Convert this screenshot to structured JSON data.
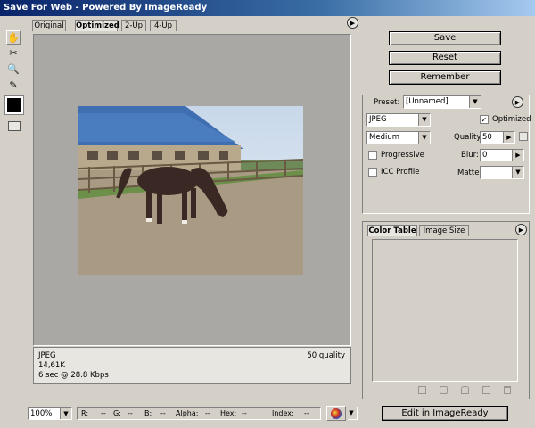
{
  "window": {
    "title": "Save For Web - Powered By ImageReady"
  },
  "tabs": [
    {
      "label": "Original"
    },
    {
      "label": "Optimized",
      "active": true
    },
    {
      "label": "2-Up"
    },
    {
      "label": "4-Up"
    }
  ],
  "image_info": {
    "format": "JPEG",
    "size": "14,61K",
    "time": "6 sec @ 28.8 Kbps",
    "quality": "50 quality"
  },
  "buttons": {
    "save": "Save",
    "reset": "Reset",
    "remember": "Remember",
    "edit_imageready": "Edit in ImageReady"
  },
  "settings": {
    "preset_label": "Preset:",
    "preset_value": "[Unnamed]",
    "format": "JPEG",
    "optimized_label": "Optimized",
    "optimized_checked": true,
    "quality_level": "Medium",
    "quality_label": "Quality:",
    "quality_value": "50",
    "progressive_label": "Progressive",
    "progressive_checked": false,
    "blur_label": "Blur:",
    "blur_value": "0",
    "icc_label": "ICC Profile",
    "icc_checked": false,
    "matte_label": "Matte:"
  },
  "panel_tabs": [
    {
      "label": "Color Table",
      "active": true
    },
    {
      "label": "Image Size"
    }
  ],
  "status": {
    "zoom": "100%",
    "r": "R:",
    "r_val": "--",
    "g": "G:",
    "g_val": "--",
    "b": "B:",
    "b_val": "--",
    "alpha": "Alpha:",
    "alpha_val": "--",
    "hex": "Hex:",
    "hex_val": "--",
    "index": "Index:",
    "index_val": "--"
  },
  "colors": {
    "titlebar_start": "#0a246a",
    "preview_bg": "#aaa8a4",
    "foreground_swatch": "#000000"
  }
}
